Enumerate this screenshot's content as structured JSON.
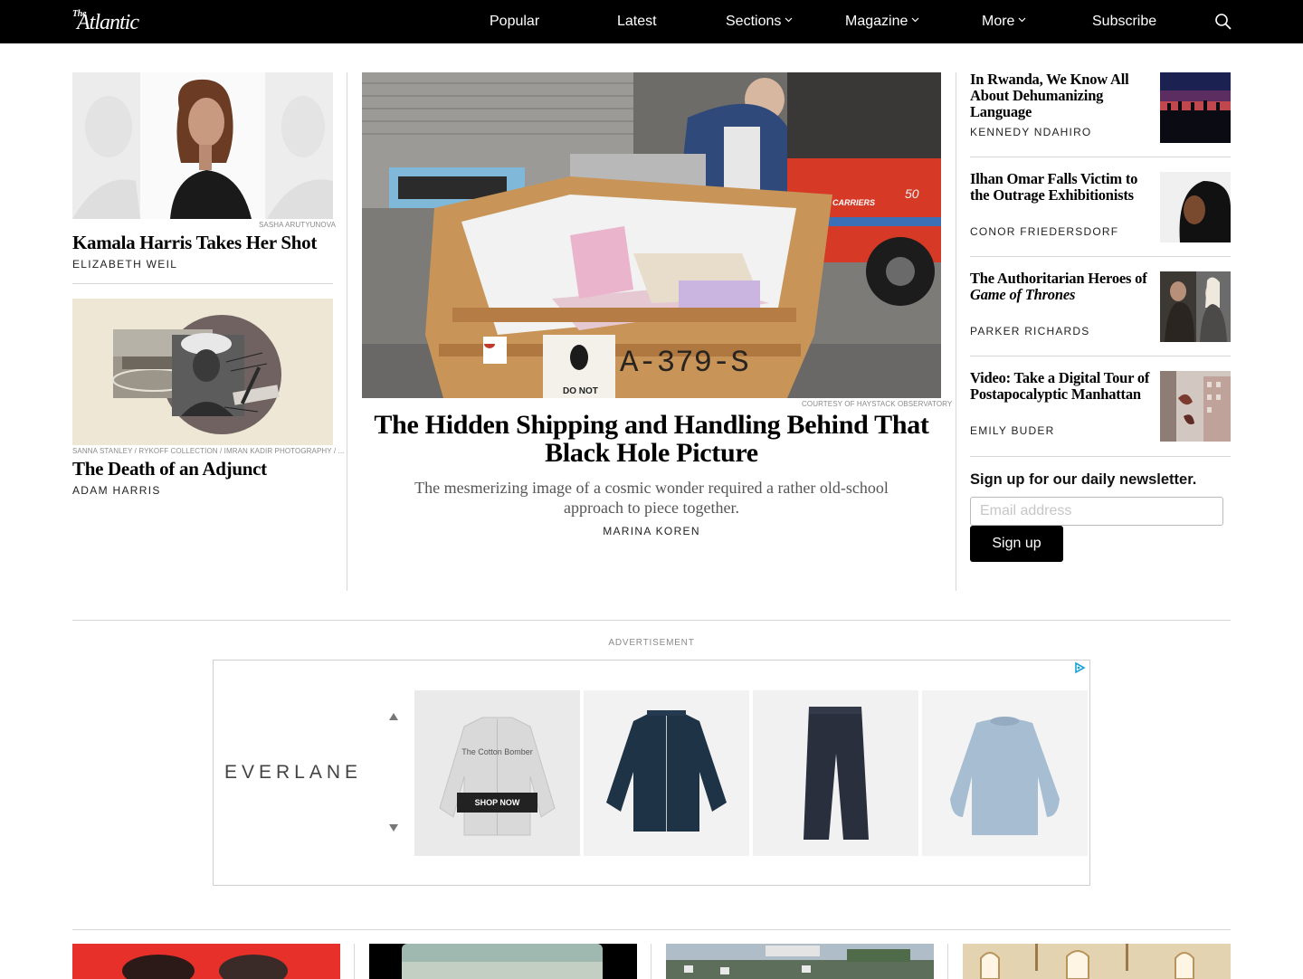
{
  "nav": {
    "logo_the": "The",
    "logo_main": "Atlantic",
    "items": [
      {
        "label": "Popular"
      },
      {
        "label": "Latest"
      },
      {
        "label": "Sections"
      },
      {
        "label": "Magazine"
      },
      {
        "label": "More"
      },
      {
        "label": "Subscribe"
      }
    ],
    "search_icon": "search-icon"
  },
  "left": {
    "story1": {
      "credit": "SASHA ARUTYUNOVA",
      "title": "Kamala Harris Takes Her Shot",
      "byline": "ELIZABETH WEIL"
    },
    "story2": {
      "credit": "SANNA STANLEY / RYKOFF COLLECTION / IMRAN KADIR PHOTOGRAPHY / ...",
      "title": "The Death of an Adjunct",
      "byline": "ADAM HARRIS"
    }
  },
  "hero": {
    "credit": "COURTESY OF HAYSTACK OBSERVATORY",
    "title": "The Hidden Shipping and Handling Behind That Black Hole Picture",
    "dek": "The mesmerizing image of a cosmic wonder required a rather old-school approach to piece together.",
    "byline": "MARINA KOREN",
    "crate_text_1": "A-379-S",
    "crate_text_2": "DO NOT",
    "forklift_text": "CARRIERS",
    "forklift_number": "50"
  },
  "sidebar": {
    "stories": [
      {
        "title": "In Rwanda, We Know All About Dehumanizing Language",
        "byline": "KENNEDY NDAHIRO"
      },
      {
        "title": "Ilhan Omar Falls Victim to the Outrage Exhibitionists",
        "byline": "CONOR FRIEDERSDORF"
      },
      {
        "title_pre": "The Authoritarian Heroes of",
        "title_em": "Game of Thrones",
        "byline": "PARKER RICHARDS"
      },
      {
        "title": "Video: Take a Digital Tour of Postapocalyptic Manhattan",
        "byline": "EMILY BUDER"
      }
    ],
    "newsletter": {
      "title": "Sign up for our daily newsletter.",
      "placeholder": "Email address",
      "button": "Sign up"
    }
  },
  "ad": {
    "label": "ADVERTISEMENT",
    "brand": "EVERLANE",
    "product_label": "The Cotton Bomber",
    "cta": "SHOP NOW",
    "adchoices_icon": "adchoices-icon"
  },
  "colors": {
    "nav_bg": "#000000",
    "rule": "#d6d6d6",
    "button_bg": "#000000"
  }
}
